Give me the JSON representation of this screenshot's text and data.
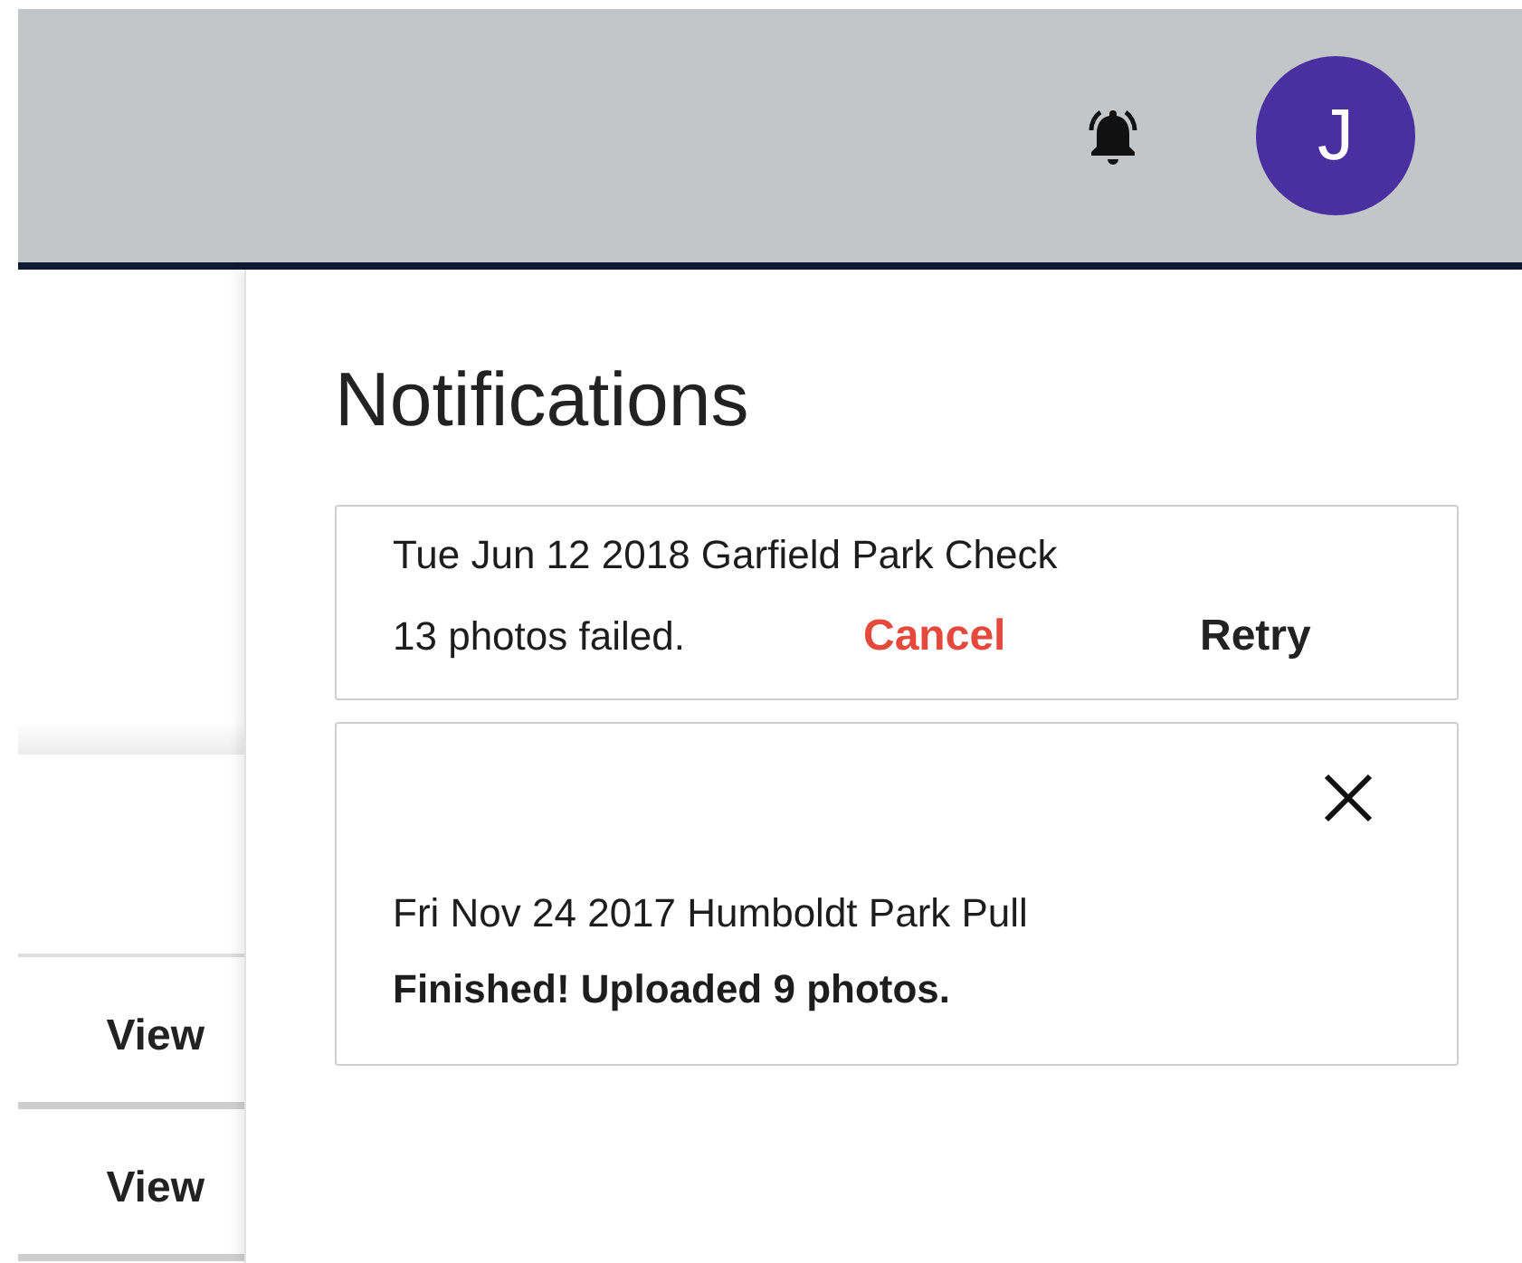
{
  "header": {
    "avatar_initial": "J"
  },
  "list": {
    "rows": [
      {
        "action": "View"
      },
      {
        "action": "View"
      }
    ]
  },
  "notifications": {
    "title": "Notifications",
    "items": [
      {
        "kind": "failed",
        "title": "Tue Jun 12 2018 Garfield Park Check",
        "message": "13 photos failed.",
        "actions": [
          {
            "label": "Cancel",
            "kind": "destructive"
          },
          {
            "label": "Retry",
            "kind": "plain"
          }
        ]
      },
      {
        "kind": "finished",
        "title": "Fri Nov 24 2017 Humboldt Park Pull",
        "message": "Finished! Uploaded 9 photos.",
        "dismissible": true
      }
    ]
  }
}
